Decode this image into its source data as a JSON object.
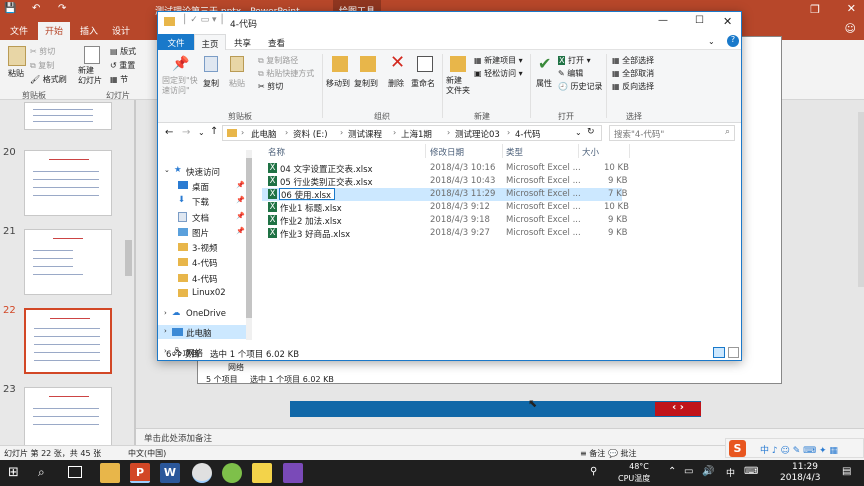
{
  "ppt": {
    "title": "测试理论第三天.pptx - PowerPoint",
    "drawing_tools": "绘图工具",
    "tabs": [
      "文件",
      "开始",
      "插入",
      "设计"
    ],
    "ribbon": {
      "paste": "粘贴",
      "cut": "剪切",
      "copy": "复制",
      "format_painter": "格式刷",
      "clipboard": "剪贴板",
      "new_slide": "新建\n幻灯片",
      "layout": "版式",
      "reset": "重置",
      "section": "节",
      "slides": "幻灯片"
    },
    "slide_numbers": [
      "20",
      "21",
      "22",
      "23"
    ],
    "notes_placeholder": "单击此处添加备注",
    "status": {
      "slide_info": "幻灯片 第 22 张，共 45 张",
      "language": "中文(中国)",
      "notes": "备注",
      "comments": "批注"
    },
    "back_explorer": {
      "status_count": "5 个项目",
      "status_sel": "选中 1 个项目  6.02 KB",
      "network": "网络"
    },
    "nav_arrows": "‹ ›"
  },
  "explorer": {
    "title": "4-代码",
    "tabs": {
      "file": "文件",
      "home": "主页",
      "share": "共享",
      "view": "查看"
    },
    "ribbon": {
      "pin": "固定到\"快\n速访问\"",
      "copy": "复制",
      "paste": "粘贴",
      "copy_path": "复制路径",
      "paste_shortcut": "粘贴快捷方式",
      "cut": "剪切",
      "group_clipboard": "剪贴板",
      "move_to": "移动到",
      "copy_to": "复制到",
      "delete": "删除",
      "rename": "重命名",
      "group_organize": "组织",
      "new_folder": "新建\n文件夹",
      "new_item": "新建项目",
      "easy_access": "轻松访问",
      "group_new": "新建",
      "properties": "属性",
      "open": "打开",
      "edit": "编辑",
      "history": "历史记录",
      "group_open": "打开",
      "select_all": "全部选择",
      "select_none": "全部取消",
      "invert": "反向选择",
      "group_select": "选择"
    },
    "breadcrumb": [
      "此电脑",
      "资料 (E:)",
      "测试课程",
      "上海1期",
      "测试理论03",
      "4-代码"
    ],
    "search_placeholder": "搜索\"4-代码\"",
    "nav": {
      "quick_access": "快速访问",
      "desktop": "桌面",
      "downloads": "下载",
      "documents": "文档",
      "pictures": "图片",
      "f1": "3-视频",
      "f2": "4-代码",
      "f3": "4-代码",
      "f4": "Linux02",
      "onedrive": "OneDrive",
      "this_pc": "此电脑",
      "network": "网络"
    },
    "columns": {
      "name": "名称",
      "date": "修改日期",
      "type": "类型",
      "size": "大小"
    },
    "files": [
      {
        "name": "04 文字设置正交表.xlsx",
        "date": "2018/4/3 10:16",
        "type": "Microsoft Excel ...",
        "size": "10 KB"
      },
      {
        "name": "05 行业类别正交表.xlsx",
        "date": "2018/4/3 10:43",
        "type": "Microsoft Excel ...",
        "size": "9 KB"
      },
      {
        "name": "06 使用.xlsx",
        "date": "2018/4/3 11:29",
        "type": "Microsoft Excel ...",
        "size": "7 KB"
      },
      {
        "name": "作业1 标题.xlsx",
        "date": "2018/4/3 9:12",
        "type": "Microsoft Excel ...",
        "size": "10 KB"
      },
      {
        "name": "作业2 加法.xlsx",
        "date": "2018/4/3 9:18",
        "type": "Microsoft Excel ...",
        "size": "9 KB"
      },
      {
        "name": "作业3 好商品.xlsx",
        "date": "2018/4/3 9:27",
        "type": "Microsoft Excel ...",
        "size": "9 KB"
      }
    ],
    "status_count": "6 个项目",
    "status_sel": "选中 1 个项目  6.02 KB"
  },
  "taskbar": {
    "temp": "48°C",
    "temp_label": "CPU温度",
    "ime": "中",
    "time": "11:29",
    "date": "2018/4/3"
  },
  "colors": {
    "ppt_accent": "#b7472a",
    "explorer_blue": "#1979ca",
    "selection": "#cce8ff",
    "excel_green": "#1f7244"
  }
}
